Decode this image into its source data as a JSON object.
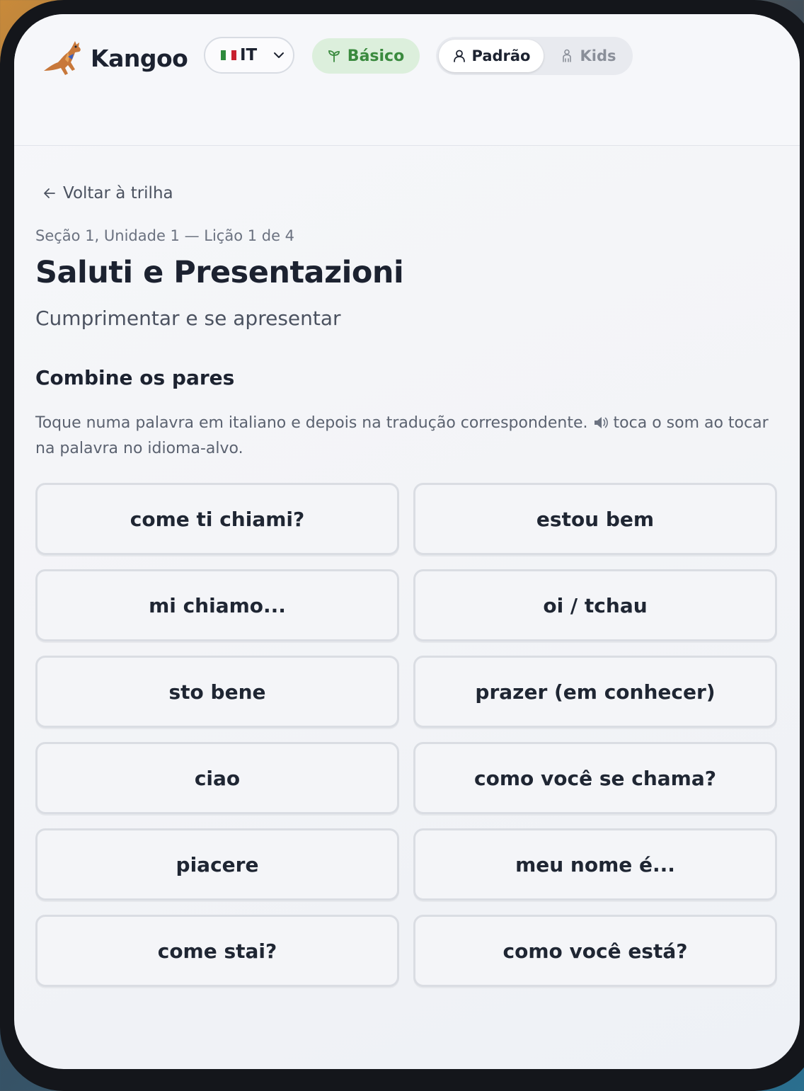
{
  "header": {
    "app_name": "Kangoo",
    "language_code": "IT",
    "level_label": "Básico",
    "modes": [
      {
        "label": "Padrão",
        "active": true
      },
      {
        "label": "Kids",
        "active": false
      }
    ]
  },
  "lesson": {
    "back_label": "Voltar à trilha",
    "breadcrumb": "Seção 1, Unidade 1 — Lição 1 de 4",
    "title": "Saluti e Presentazioni",
    "subtitle": "Cumprimentar e se apresentar"
  },
  "exercise": {
    "heading": "Combine os pares",
    "instructions_before": "Toque numa palavra em italiano e depois na tradução correspondente.",
    "instructions_after": "toca o som ao tocar na palavra no idioma-alvo.",
    "left_words": [
      "come ti chiami?",
      "mi chiamo...",
      "sto bene",
      "ciao",
      "piacere",
      "come stai?"
    ],
    "right_words": [
      "estou bem",
      "oi / tchau",
      "prazer (em conhecer)",
      "como você se chama?",
      "meu nome é...",
      "como você está?"
    ]
  },
  "colors": {
    "accent_green": "#3a8a3e",
    "accent_green_bg": "#dcefdc",
    "text_dark": "#1c2230",
    "flag": [
      "#2e8b3c",
      "#ffffff",
      "#c8202e"
    ]
  },
  "icons": [
    "kangaroo-logo-icon",
    "chevron-down-icon",
    "sprout-icon",
    "person-icon",
    "child-icon",
    "arrow-left-icon",
    "speaker-icon"
  ]
}
